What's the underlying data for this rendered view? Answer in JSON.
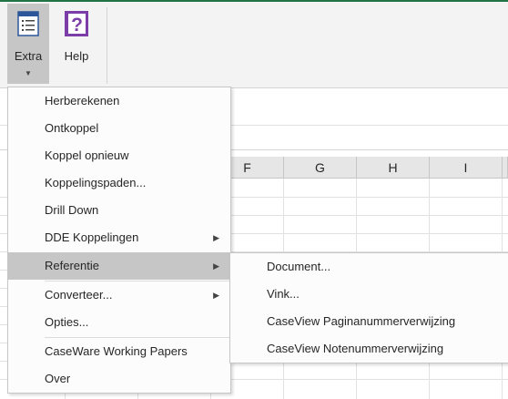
{
  "ribbon": {
    "extra_label": "Extra",
    "help_label": "Help"
  },
  "columns": [
    "F",
    "G",
    "H",
    "I"
  ],
  "menu": {
    "items": [
      {
        "label": "Herberekenen"
      },
      {
        "label": "Ontkoppel"
      },
      {
        "label": "Koppel opnieuw"
      },
      {
        "label": "Koppelingspaden..."
      },
      {
        "label": "Drill Down"
      },
      {
        "label": "DDE Koppelingen"
      },
      {
        "label": "Referentie"
      },
      {
        "label": "Converteer..."
      },
      {
        "label": "Opties..."
      },
      {
        "label": "CaseWare Working Papers"
      },
      {
        "label": "Over"
      }
    ]
  },
  "submenu": {
    "items": [
      {
        "label": "Document..."
      },
      {
        "label": "Vink..."
      },
      {
        "label": "CaseView Paginanummerverwijzing"
      },
      {
        "label": "CaseView Notenummerverwijzing"
      }
    ]
  },
  "colors": {
    "accent": "#217346",
    "menu_highlight": "#c6c6c6",
    "help_icon": "#7b3ea8"
  }
}
